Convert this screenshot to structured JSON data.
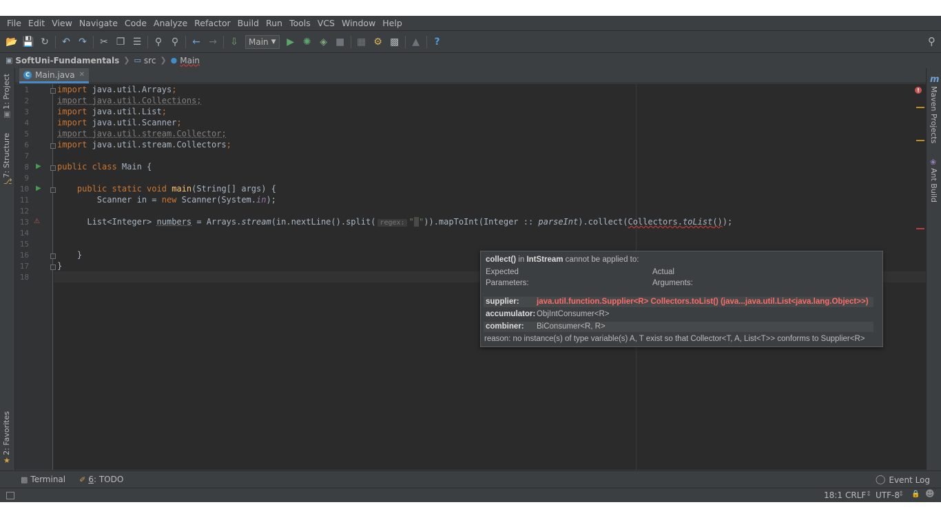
{
  "menu": [
    "File",
    "Edit",
    "View",
    "Navigate",
    "Code",
    "Analyze",
    "Refactor",
    "Build",
    "Run",
    "Tools",
    "VCS",
    "Window",
    "Help"
  ],
  "toolbar": {
    "run_config": "Main",
    "help_label": "?"
  },
  "breadcrumb": {
    "project": "SoftUni-Fundamentals",
    "folder": "src",
    "file": "Main"
  },
  "left_tools": {
    "project": "1: Project",
    "structure": "7: Structure",
    "favorites": "2: Favorites"
  },
  "right_tools": {
    "maven_icon": "m",
    "maven": "Maven Projects",
    "ant": "Ant Build"
  },
  "editor": {
    "tab_label": "Main.java",
    "tab_icon_letter": "C",
    "line_numbers": [
      "1",
      "2",
      "3",
      "4",
      "5",
      "6",
      "7",
      "8",
      "9",
      "10",
      "11",
      "12",
      "13",
      "14",
      "15",
      "16",
      "17",
      "18"
    ],
    "lines": {
      "l1_kw": "import",
      "l1_rest": " java.util.Arrays",
      "l1_semi": ";",
      "l2": "import java.util.Collections;",
      "l3_kw": "import",
      "l3_rest": " java.util.List",
      "l3_semi": ";",
      "l4_kw": "import",
      "l4_rest": " java.util.Scanner",
      "l4_semi": ";",
      "l5": "import java.util.stream.Collector;",
      "l6_kw": "import",
      "l6_rest": " java.util.stream.Collectors",
      "l6_semi": ";",
      "l8_kw": "public class",
      "l8_rest": " Main {",
      "l10_kw": "public static void",
      "l10_fn": "main",
      "l10_rest": "(String[] args) {",
      "l11_a": "Scanner in = ",
      "l11_kw": "new",
      "l11_b": " Scanner(System.",
      "l11_in": "in",
      "l11_c": ");",
      "l13_a": "List<Integer> ",
      "l13_var": "numbers",
      "l13_b": " = Arrays.",
      "l13_stream": "stream",
      "l13_c": "(in.nextLine().split(",
      "l13_hint": "regex:",
      "l13_q1": "\"",
      "l13_sp": " ",
      "l13_q2": "\"",
      "l13_d": ")).mapToInt(Integer :: ",
      "l13_parse": "parseInt",
      "l13_e": ").collect(",
      "l13_coll": "Collectors.",
      "l13_tolist": "toList",
      "l13_f": "()",
      "l13_g": ");",
      "l16": "}",
      "l17": "}"
    }
  },
  "tooltip": {
    "method": "collect()",
    "in": " in ",
    "type": "IntStream",
    "msg": " cannot be applied to:",
    "expected": "Expected",
    "parameters": "Parameters:",
    "actual": "Actual",
    "arguments": "Arguments:",
    "rows": [
      {
        "label": "supplier:",
        "value": "java.util.function.Supplier<R> Collectors.toList()  (java...java.util.List<java.lang.Object>>)"
      },
      {
        "label": "accumulator:",
        "value": "ObjIntConsumer<R>"
      },
      {
        "label": "combiner:",
        "value": "BiConsumer<R, R>"
      }
    ],
    "reason": "reason: no instance(s) of type variable(s) A, T exist so that Collector<T, A, List<T>> conforms to Supplier<R>"
  },
  "bottom_tools": {
    "terminal": "Terminal",
    "todo_num": "6",
    "todo": ": TODO",
    "event_log": "Event Log"
  },
  "status": {
    "position": "18:1",
    "line_sep": "CRLF",
    "encoding": "UTF-8"
  },
  "colors": {
    "keyword": "#cc7832",
    "error": "#c75450",
    "accent": "#4a88c7",
    "run_green": "#499c54"
  }
}
